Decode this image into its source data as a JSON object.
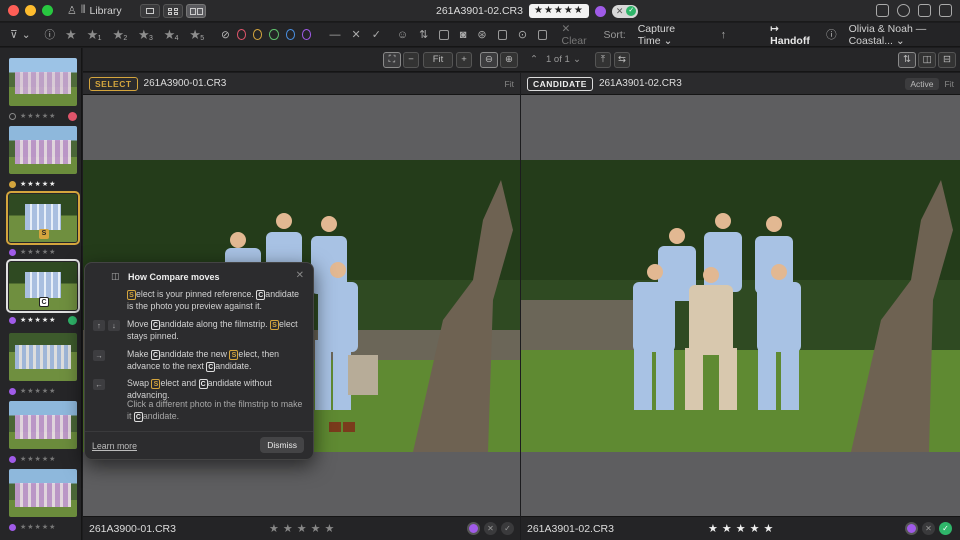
{
  "titlebar": {
    "library_label": "Library",
    "filename": "261A3901-02.CR3",
    "stars": "★★★★★"
  },
  "toolbar": {
    "star_filters": [
      "1",
      "2",
      "3",
      "4",
      "5"
    ],
    "ring_colors": [
      "#e0556b",
      "#d4a53d",
      "#5fbf6c",
      "#4a90e2",
      "#a05be8"
    ],
    "clear_label": "Clear",
    "sort_label": "Sort:",
    "sort_value": "Capture Time",
    "handoff_label": "Handoff",
    "project_label": "Olivia & Noah — Coastal..."
  },
  "viewbar": {
    "zoom_label": "Fit",
    "page_indicator": "1 of 1"
  },
  "left_pane": {
    "tag": "SELECT",
    "filename": "261A3900-01.CR3",
    "zoom": "Fit",
    "footer_filename": "261A3900-01.CR3",
    "footer_stars": "★★★★★"
  },
  "right_pane": {
    "tag": "CANDIDATE",
    "filename": "261A3901-02.CR3",
    "active_label": "Active",
    "zoom": "Fit",
    "footer_filename": "261A3901-02.CR3",
    "footer_stars": "★★★★★"
  },
  "popover": {
    "title": "How Compare moves",
    "rows": [
      {
        "a": "elect is your pinned reference. ",
        "b": "andidate is the photo you preview against it."
      },
      {
        "a": "Move ",
        "b": "andidate along the filmstrip. ",
        "c": "elect stays pinned."
      },
      {
        "a": "Make ",
        "b": "andidate the new ",
        "c": "elect, then advance to the next ",
        "d": "andidate."
      },
      {
        "a": "Swap ",
        "b": "elect and ",
        "c": "andidate without advancing."
      },
      {
        "a": "Click a different photo in the filmstrip to make it ",
        "b": "andidate."
      }
    ],
    "learn_more": "Learn more",
    "dismiss": "Dismiss"
  },
  "filmstrip": {
    "thumbs": [
      {
        "stars": "★★★★★",
        "status": "rejected"
      },
      {
        "stars": "★★★★★",
        "status": "none"
      },
      {
        "stars": "★★★★★",
        "status": "select"
      },
      {
        "stars": "★★★★★",
        "status": "candidate"
      },
      {
        "stars": "★★★★★",
        "status": "none"
      },
      {
        "stars": "★★★★★",
        "status": "none"
      },
      {
        "stars": "★★★★★",
        "status": "none"
      }
    ],
    "badge_s": "S",
    "badge_c": "C"
  },
  "colors": {
    "select_accent": "#d4a53d",
    "purple_label": "#a05be8",
    "green_flag": "#2fb56a",
    "reject_flag": "#e0556b"
  }
}
